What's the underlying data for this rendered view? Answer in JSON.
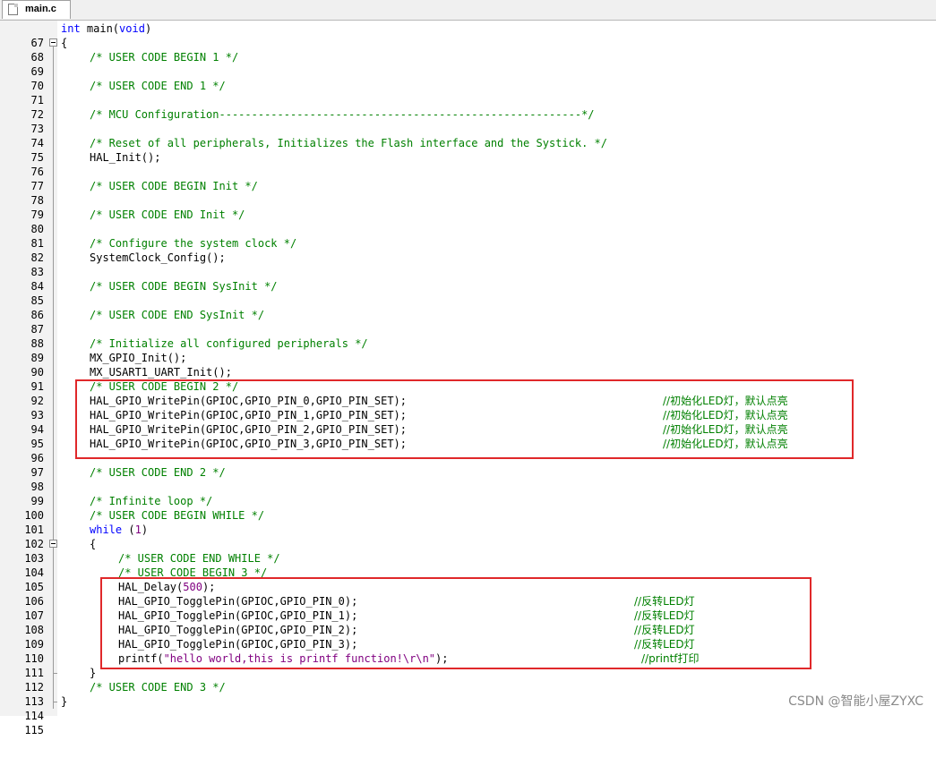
{
  "tab": {
    "label": "main.c"
  },
  "watermark": "CSDN @智能小屋ZYXC",
  "lines": {
    "l67": {
      "n": "67",
      "a": "int",
      "b": " main(",
      "c": "void",
      "d": ")"
    },
    "l68": {
      "n": "68",
      "t": "{"
    },
    "l69": {
      "n": "69",
      "t": "/* USER CODE BEGIN 1 */"
    },
    "l70": {
      "n": "70"
    },
    "l71": {
      "n": "71",
      "t": "/* USER CODE END 1 */"
    },
    "l72": {
      "n": "72"
    },
    "l73": {
      "n": "73",
      "t": "/* MCU Configuration--------------------------------------------------------*/"
    },
    "l74": {
      "n": "74"
    },
    "l75": {
      "n": "75",
      "t": "/* Reset of all peripherals, Initializes the Flash interface and the Systick. */"
    },
    "l76": {
      "n": "76",
      "t": "HAL_Init();"
    },
    "l77": {
      "n": "77"
    },
    "l78": {
      "n": "78",
      "t": "/* USER CODE BEGIN Init */"
    },
    "l79": {
      "n": "79"
    },
    "l80": {
      "n": "80",
      "t": "/* USER CODE END Init */"
    },
    "l81": {
      "n": "81"
    },
    "l82": {
      "n": "82",
      "t": "/* Configure the system clock */"
    },
    "l83": {
      "n": "83",
      "t": "SystemClock_Config();"
    },
    "l84": {
      "n": "84"
    },
    "l85": {
      "n": "85",
      "t": "/* USER CODE BEGIN SysInit */"
    },
    "l86": {
      "n": "86"
    },
    "l87": {
      "n": "87",
      "t": "/* USER CODE END SysInit */"
    },
    "l88": {
      "n": "88"
    },
    "l89": {
      "n": "89",
      "t": "/* Initialize all configured peripherals */"
    },
    "l90": {
      "n": "90",
      "t": "MX_GPIO_Init();"
    },
    "l91": {
      "n": "91",
      "t": "MX_USART1_UART_Init();"
    },
    "l92": {
      "n": "92",
      "t": "/* USER CODE BEGIN 2 */"
    },
    "l93": {
      "n": "93",
      "t": "HAL_GPIO_WritePin(GPIOC,GPIO_PIN_0,GPIO_PIN_SET);",
      "c": "//初始化LED灯，默认点亮"
    },
    "l94": {
      "n": "94",
      "t": "HAL_GPIO_WritePin(GPIOC,GPIO_PIN_1,GPIO_PIN_SET);",
      "c": "//初始化LED灯，默认点亮"
    },
    "l95": {
      "n": "95",
      "t": "HAL_GPIO_WritePin(GPIOC,GPIO_PIN_2,GPIO_PIN_SET);",
      "c": "//初始化LED灯，默认点亮"
    },
    "l96": {
      "n": "96",
      "t": "HAL_GPIO_WritePin(GPIOC,GPIO_PIN_3,GPIO_PIN_SET);",
      "c": "//初始化LED灯，默认点亮"
    },
    "l97": {
      "n": "97"
    },
    "l98": {
      "n": "98",
      "t": "/* USER CODE END 2 */"
    },
    "l99": {
      "n": "99"
    },
    "l100": {
      "n": "100",
      "t": "/* Infinite loop */"
    },
    "l101": {
      "n": "101",
      "t": "/* USER CODE BEGIN WHILE */"
    },
    "l102": {
      "n": "102",
      "a": "while",
      "b": " (",
      "c": "1",
      "d": ")"
    },
    "l103": {
      "n": "103",
      "t": "{"
    },
    "l104": {
      "n": "104",
      "t": "/* USER CODE END WHILE */"
    },
    "l105": {
      "n": "105",
      "t": "/* USER CODE BEGIN 3 */"
    },
    "l106": {
      "n": "106",
      "a": "HAL_Delay(",
      "b": "500",
      "c": ");"
    },
    "l107": {
      "n": "107",
      "t": "HAL_GPIO_TogglePin(GPIOC,GPIO_PIN_0);",
      "c": "//反转LED灯"
    },
    "l108": {
      "n": "108",
      "t": "HAL_GPIO_TogglePin(GPIOC,GPIO_PIN_1);",
      "c": "//反转LED灯"
    },
    "l109": {
      "n": "109",
      "t": "HAL_GPIO_TogglePin(GPIOC,GPIO_PIN_2);",
      "c": "//反转LED灯"
    },
    "l110": {
      "n": "110",
      "t": "HAL_GPIO_TogglePin(GPIOC,GPIO_PIN_3);",
      "c": "//反转LED灯"
    },
    "l111": {
      "n": "111",
      "a": "printf(",
      "b": "\"hello world,this is printf function!\\r\\n\"",
      "c": ");",
      "cm": "//printf打印"
    },
    "l112": {
      "n": "112",
      "t": "}"
    },
    "l113": {
      "n": "113",
      "t": "/* USER CODE END 3 */"
    },
    "l114": {
      "n": "114",
      "t": "}"
    },
    "l115": {
      "n": "115"
    }
  }
}
